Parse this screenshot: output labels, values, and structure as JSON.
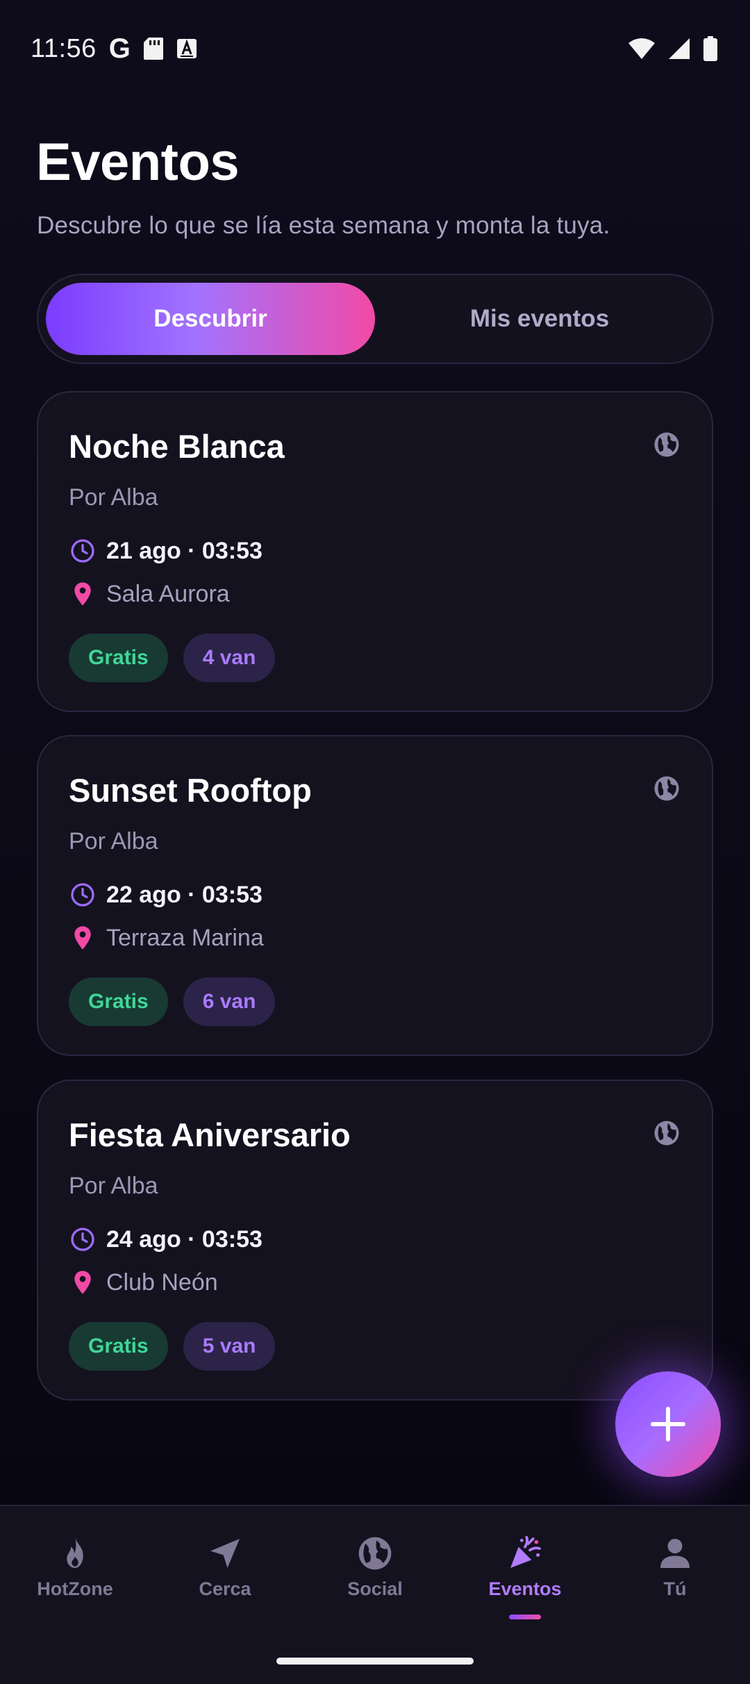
{
  "status_bar": {
    "time": "11:56",
    "g_glyph": "G",
    "icons": [
      "google-icon",
      "sd-card-icon",
      "font-icon",
      "wifi-icon",
      "signal-icon",
      "battery-icon"
    ]
  },
  "header": {
    "title": "Eventos",
    "subtitle": "Descubre lo que se lía esta semana y monta la tuya."
  },
  "tabs": [
    {
      "label": "Descubrir",
      "active": true
    },
    {
      "label": "Mis eventos",
      "active": false
    }
  ],
  "events": [
    {
      "title": "Noche Blanca",
      "host": "Por Alba",
      "datetime": "21 ago · 03:53",
      "place": "Sala Aurora",
      "price": "Gratis",
      "going": "4 van"
    },
    {
      "title": "Sunset Rooftop",
      "host": "Por Alba",
      "datetime": "22 ago · 03:53",
      "place": "Terraza Marina",
      "price": "Gratis",
      "going": "6 van"
    },
    {
      "title": "Fiesta Aniversario",
      "host": "Por Alba",
      "datetime": "24 ago · 03:53",
      "place": "Club Neón",
      "price": "Gratis",
      "going": "5 van"
    }
  ],
  "nav": [
    {
      "label": "HotZone",
      "icon": "flame-icon",
      "active": false
    },
    {
      "label": "Cerca",
      "icon": "navigation-arrow-icon",
      "active": false
    },
    {
      "label": "Social",
      "icon": "globe-icon",
      "active": false
    },
    {
      "label": "Eventos",
      "icon": "party-popper-icon",
      "active": true
    },
    {
      "label": "Tú",
      "icon": "person-icon",
      "active": false
    }
  ],
  "colors": {
    "background": "#0c0a17",
    "card": "#15121f",
    "accent_purple": "#7b3cff",
    "accent_pink": "#f24aa6",
    "free_green": "#3fd69a",
    "going_purple": "#a97bff",
    "nav_active": "#b27cff"
  }
}
